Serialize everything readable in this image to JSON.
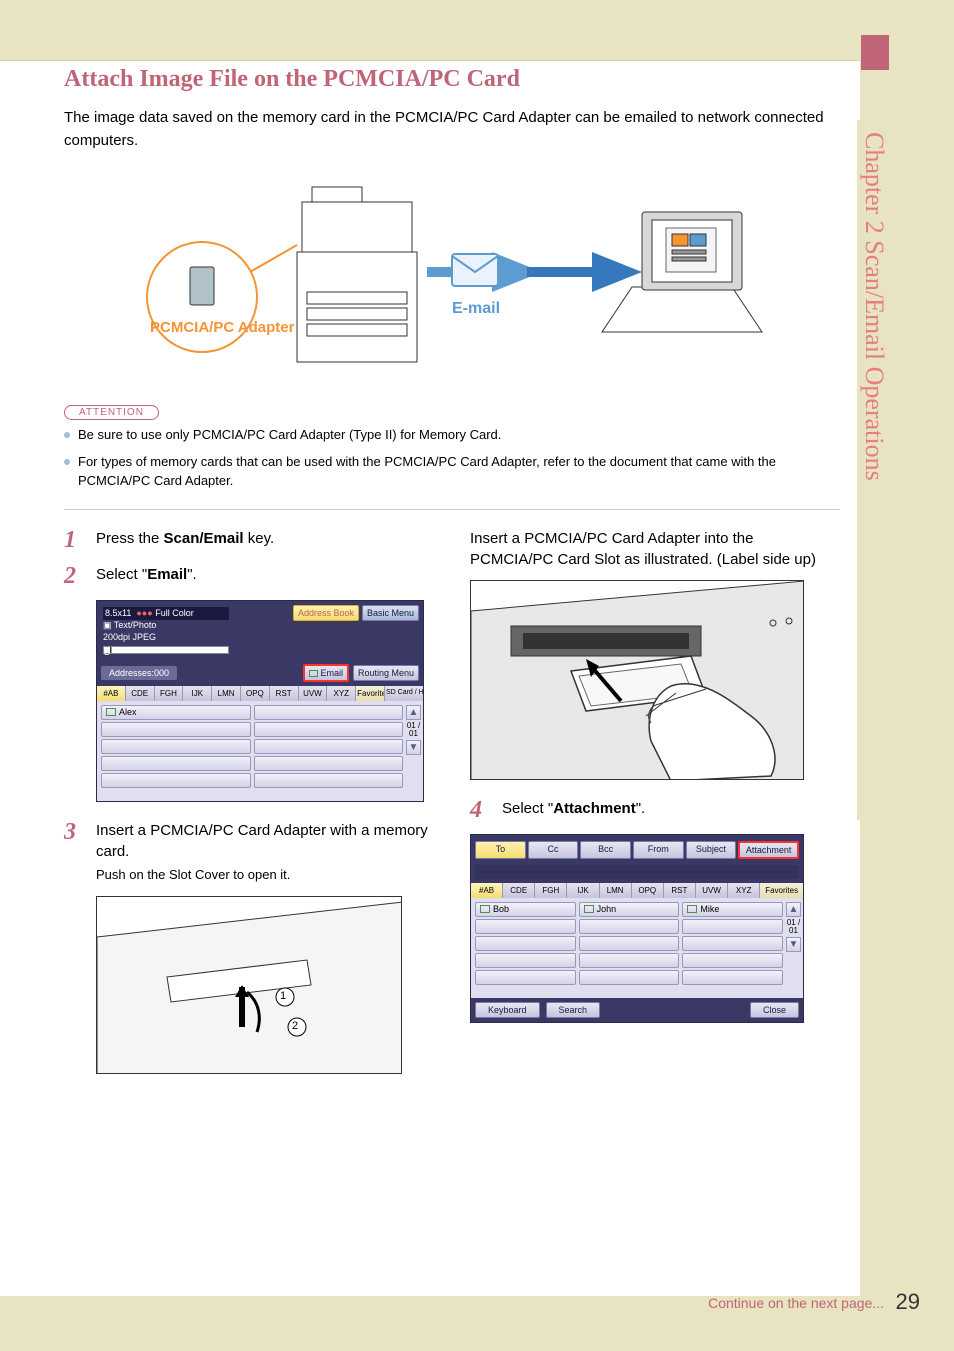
{
  "chapter_tab": "Chapter 2  Scan/Email Operations",
  "title": "Attach Image File on the PCMCIA/PC Card",
  "intro": "The image data saved on the memory card in the PCMCIA/PC Card Adapter can be emailed to network connected computers.",
  "diagram": {
    "adapter_label": "PCMCIA/PC Adapter",
    "email_label": "E-mail"
  },
  "attention_label": "ATTENTION",
  "attention": [
    "Be sure to use only PCMCIA/PC Card Adapter (Type II) for Memory Card.",
    "For types of memory cards that can be used with the PCMCIA/PC Card Adapter, refer to the document that came with the PCMCIA/PC Card Adapter."
  ],
  "steps": {
    "s1": {
      "num": "1",
      "text_pre": "Press the ",
      "bold": "Scan/Email",
      "text_post": " key."
    },
    "s2": {
      "num": "2",
      "text_pre": "Select \"",
      "bold": "Email",
      "text_post": "\"."
    },
    "s3": {
      "num": "3",
      "text": "Insert a PCMCIA/PC Card Adapter with a memory card.",
      "sub": "Push on the Slot Cover to open it."
    },
    "s3b": {
      "text": "Insert a PCMCIA/PC Card Adapter into the PCMCIA/PC Card Slot as illustrated. (Label side up)"
    },
    "s4": {
      "num": "4",
      "text_pre": "Select \"",
      "bold": "Attachment",
      "text_post": "\"."
    }
  },
  "screen1": {
    "paper": "8.5x11",
    "color": "Full Color",
    "mode": "Text/Photo",
    "res": "200dpi JPEG",
    "addresses": "Addresses:000",
    "address_book": "Address Book",
    "basic_menu": "Basic Menu",
    "email": "Email",
    "routing": "Routing Menu",
    "tabs": [
      "#AB",
      "CDE",
      "FGH",
      "IJK",
      "LMN",
      "OPQ",
      "RST",
      "UVW",
      "XYZ",
      "Favorites",
      "SD Card / Hard Drive"
    ],
    "entry": "Alex",
    "scroll": "01 / 01"
  },
  "screen2": {
    "fields": [
      "To",
      "Cc",
      "Bcc",
      "From",
      "Subject",
      "Attachment"
    ],
    "tabs": [
      "#AB",
      "CDE",
      "FGH",
      "IJK",
      "LMN",
      "OPQ",
      "RST",
      "UVW",
      "XYZ",
      "Favorites"
    ],
    "entries": [
      "Bob",
      "John",
      "Mike"
    ],
    "scroll": "01 / 01",
    "keyboard": "Keyboard",
    "search": "Search",
    "close": "Close"
  },
  "markers": {
    "one": "1",
    "two": "2"
  },
  "continue": "Continue on the next page...",
  "page_number": "29"
}
